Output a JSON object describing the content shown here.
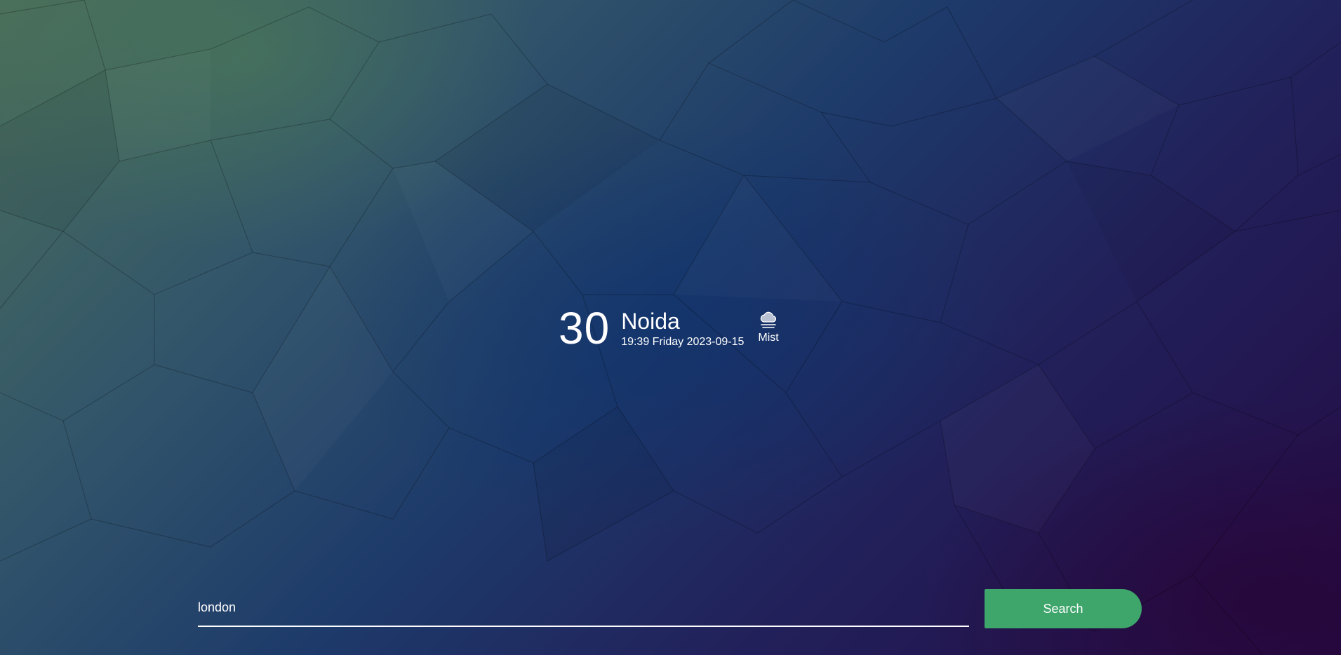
{
  "weather": {
    "temperature": "30",
    "city": "Noida",
    "datetime": "19:39 Friday 2023-09-15",
    "condition": "Mist",
    "condition_icon": "mist-cloud-icon"
  },
  "search": {
    "value": "london",
    "button_label": "Search"
  },
  "colors": {
    "accent": "#3ea56b",
    "text": "#ffffff"
  }
}
